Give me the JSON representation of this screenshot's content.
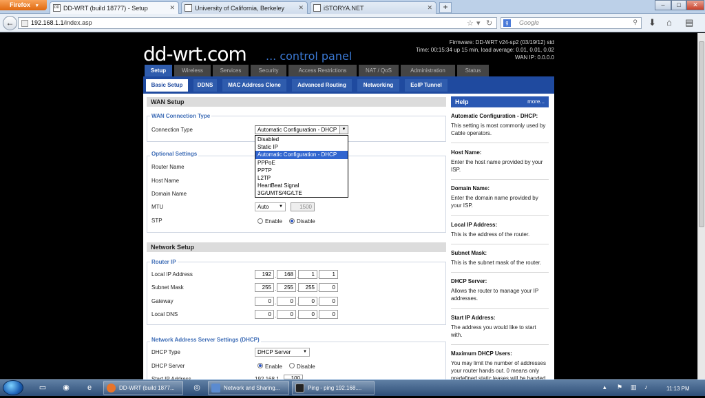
{
  "browser": {
    "menu_label": "Firefox",
    "tabs": [
      {
        "title": "DD-WRT (build 18777) - Setup",
        "favicon": "dd"
      },
      {
        "title": "University of California, Berkeley",
        "favicon": "ucb"
      },
      {
        "title": "iSTORYA.NET",
        "favicon": "i"
      }
    ],
    "new_tab": "+",
    "url_gray": "192.168.1.1",
    "url_rest": "/index.asp",
    "search_placeholder": "Google",
    "window_controls": [
      "–",
      "□",
      "✕"
    ]
  },
  "router": {
    "logo": "dd-wrt.com",
    "subtitle": "... control panel",
    "firmware": "Firmware: DD-WRT v24-sp2 (03/19/12) std",
    "time": "Time: 00:15:34 up 15 min, load average: 0.01, 0.01, 0.02",
    "wan_ip": "WAN IP: 0.0.0.0",
    "main_tabs": [
      "Setup",
      "Wireless",
      "Services",
      "Security",
      "Access Restrictions",
      "NAT / QoS",
      "Administration",
      "Status"
    ],
    "sub_tabs": [
      "Basic Setup",
      "DDNS",
      "MAC Address Clone",
      "Advanced Routing",
      "Networking",
      "EoIP Tunnel"
    ]
  },
  "wan": {
    "section_title": "WAN Setup",
    "conn_legend": "WAN Connection Type",
    "conn_label": "Connection Type",
    "conn_value": "Automatic Configuration - DHCP",
    "conn_options": [
      "Disabled",
      "Static IP",
      "Automatic Configuration - DHCP",
      "PPPoE",
      "PPTP",
      "L2TP",
      "HeartBeat Signal",
      "3G/UMTS/4G/LTE"
    ],
    "opt_legend": "Optional Settings",
    "router_name": "Router Name",
    "host_name": "Host Name",
    "domain_name": "Domain Name",
    "mtu_label": "MTU",
    "mtu_mode": "Auto",
    "mtu_value": "1500",
    "stp_label": "STP",
    "enable": "Enable",
    "disable": "Disable"
  },
  "network": {
    "section_title": "Network Setup",
    "router_ip_legend": "Router IP",
    "local_ip_label": "Local IP Address",
    "local_ip": [
      "192",
      "168",
      "1",
      "1"
    ],
    "subnet_label": "Subnet Mask",
    "subnet": [
      "255",
      "255",
      "255",
      "0"
    ],
    "gateway_label": "Gateway",
    "gateway": [
      "0",
      "0",
      "0",
      "0"
    ],
    "dns_label": "Local DNS",
    "dns": [
      "0",
      "0",
      "0",
      "0"
    ],
    "dhcp_legend": "Network Address Server Settings (DHCP)",
    "dhcp_type_label": "DHCP Type",
    "dhcp_type": "DHCP Server",
    "dhcp_server_label": "DHCP Server",
    "enable": "Enable",
    "disable": "Disable",
    "start_ip_label": "Start IP Address",
    "start_ip_prefix": "192.168.1.",
    "start_ip_last": "100"
  },
  "help": {
    "title": "Help",
    "more": "more...",
    "items": [
      {
        "t": "Automatic Configuration - DHCP:",
        "d": "This setting is most commonly used by Cable operators."
      },
      {
        "t": "Host Name:",
        "d": "Enter the host name provided by your ISP."
      },
      {
        "t": "Domain Name:",
        "d": "Enter the domain name provided by your ISP."
      },
      {
        "t": "Local IP Address:",
        "d": "This is the address of the router."
      },
      {
        "t": "Subnet Mask:",
        "d": "This is the subnet mask of the router."
      },
      {
        "t": "DHCP Server:",
        "d": "Allows the router to manage your IP addresses."
      },
      {
        "t": "Start IP Address:",
        "d": "The address you would like to start with."
      },
      {
        "t": "Maximum DHCP Users:",
        "d": "You may limit the number of addresses your router hands out. 0 means only predefined static leases will be handed"
      }
    ]
  },
  "taskbar": {
    "buttons": [
      "DD-WRT (build 1877...",
      "Network and Sharing...",
      "Ping - ping  192.168...."
    ],
    "clock": "11:13 PM"
  }
}
